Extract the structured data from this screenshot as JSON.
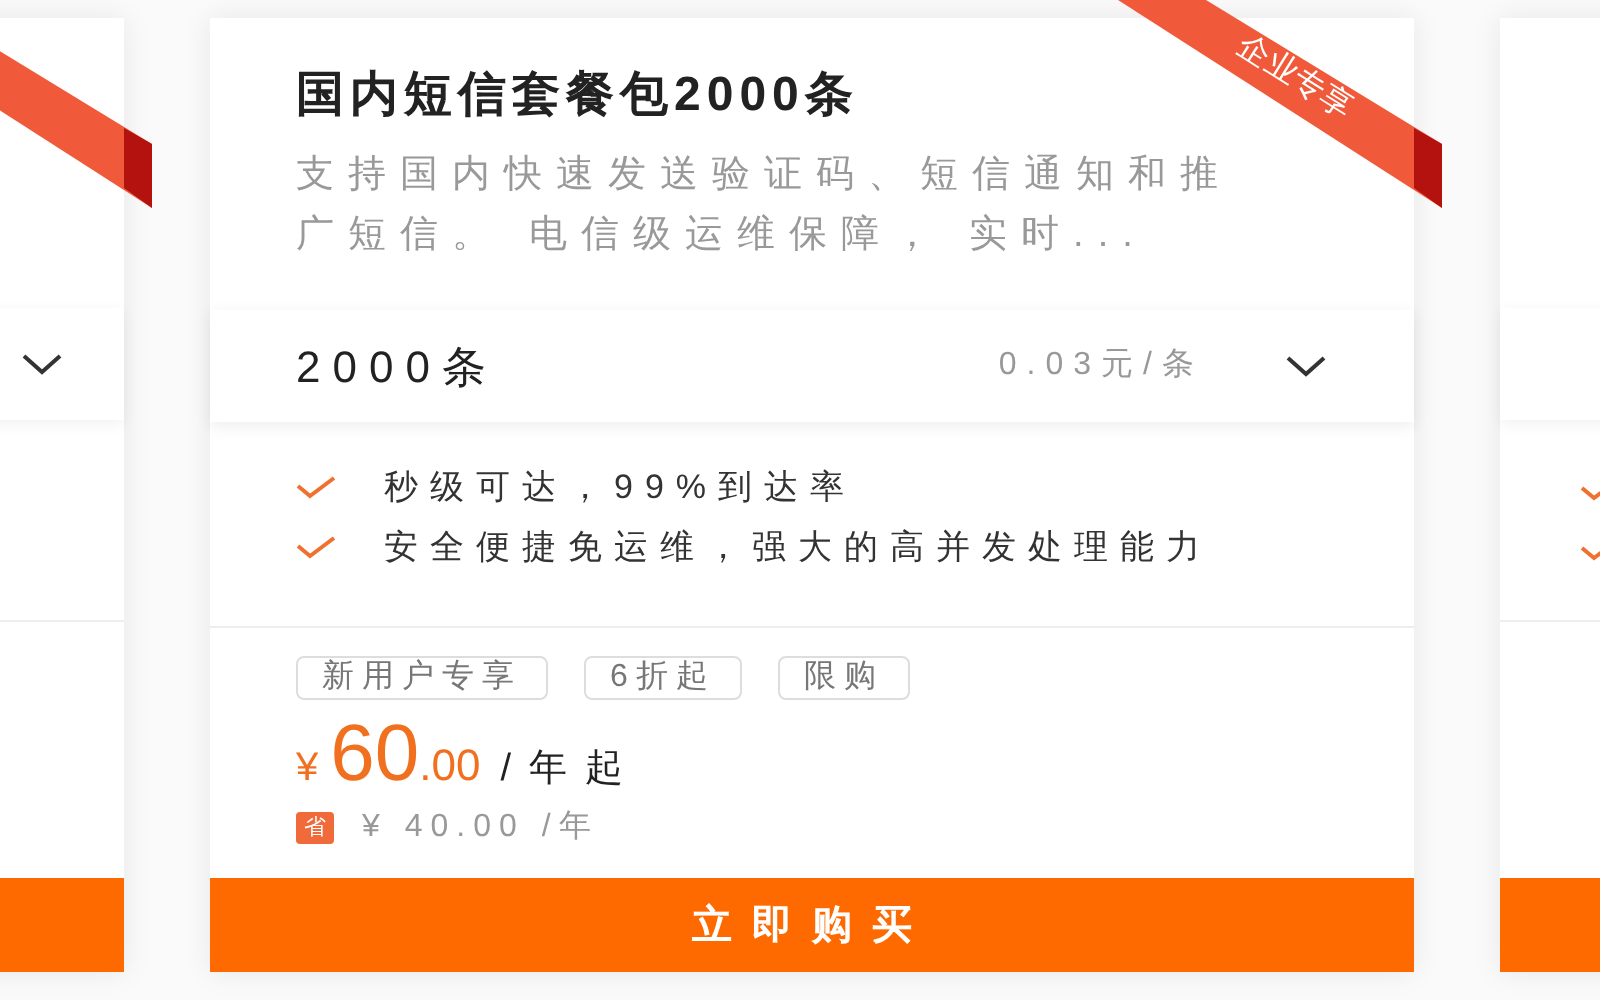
{
  "card": {
    "ribbon": "企业专享",
    "title": "国内短信套餐包2000条",
    "description": "支持国内快速发送验证码、短信通知和推广短信。 电信级运维保障， 实时...",
    "spec": {
      "value": "2000条",
      "unit_price": "0.03元/条"
    },
    "features": [
      "秒级可达，99%到达率",
      "安全便捷免运维，强大的高并发处理能力"
    ],
    "tags": [
      "新用户专享",
      "6折起",
      "限购"
    ],
    "price": {
      "currency": "¥",
      "integer": "60",
      "decimal": ".00",
      "suffix": "/年起"
    },
    "saving": {
      "badge": "省",
      "text": "¥ 40.00 /年"
    },
    "buy_button": "立即购买"
  }
}
